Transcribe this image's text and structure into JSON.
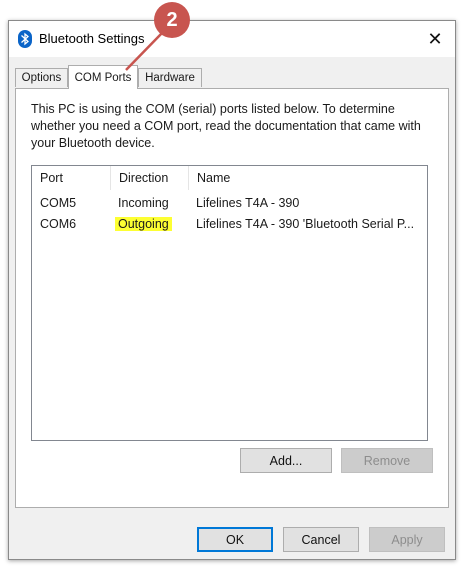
{
  "window": {
    "title": "Bluetooth Settings",
    "close_label": "✕",
    "icon": "bluetooth-icon"
  },
  "tabs": [
    {
      "label": "Options",
      "active": false
    },
    {
      "label": "COM Ports",
      "active": true
    },
    {
      "label": "Hardware",
      "active": false
    }
  ],
  "panel": {
    "description": "This PC is using the COM (serial) ports listed below. To determine whether you need a COM port, read the documentation that came with your Bluetooth device."
  },
  "ports_table": {
    "columns": [
      "Port",
      "Direction",
      "Name"
    ],
    "rows": [
      {
        "port": "COM5",
        "direction": "Incoming",
        "name": "Lifelines T4A - 390"
      },
      {
        "port": "COM6",
        "direction": "Outgoing",
        "name": "Lifelines T4A - 390 'Bluetooth Serial P..."
      }
    ]
  },
  "buttons": {
    "add": "Add...",
    "remove": "Remove",
    "ok": "OK",
    "cancel": "Cancel",
    "apply": "Apply"
  },
  "annotation": {
    "step_number": "2",
    "color": "#c8554f"
  },
  "colors": {
    "highlight": "#fdff33",
    "focus_border": "#0078d7"
  }
}
